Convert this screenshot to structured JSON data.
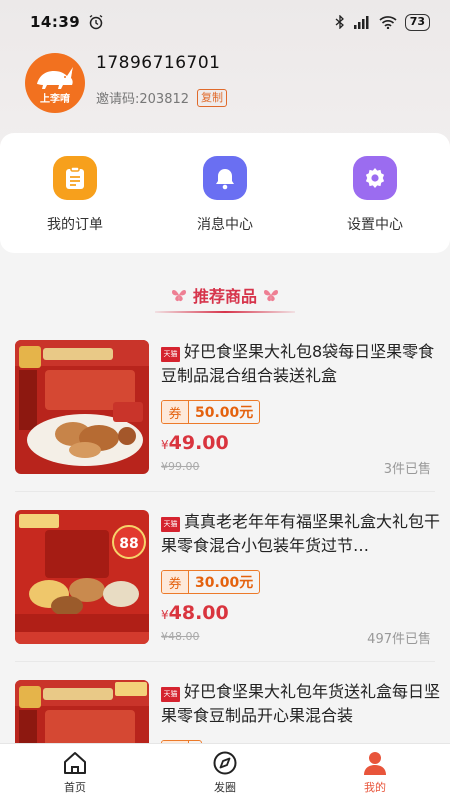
{
  "status": {
    "time": "14:39",
    "battery": "73"
  },
  "profile": {
    "phone": "17896716701",
    "invite_label": "邀请码:203812",
    "copy_label": "复制",
    "avatar_text": "上李唷"
  },
  "quick_actions": [
    {
      "label": "我的订单",
      "icon": "order-icon",
      "color": "#f7a01c"
    },
    {
      "label": "消息中心",
      "icon": "bell-icon",
      "color": "#6a6ff2"
    },
    {
      "label": "设置中心",
      "icon": "gear-icon",
      "color": "#9b6cf0"
    }
  ],
  "recommend_title": "推荐商品",
  "products": [
    {
      "store_tag": "天猫",
      "title": "好巴食坚果大礼包8袋每日坚果零食豆制品混合组合装送礼盒",
      "coupon_tag": "券",
      "coupon_value": "50.00元",
      "price": "49.00",
      "currency": "¥",
      "original_price": "¥99.00",
      "sold": "3件已售"
    },
    {
      "store_tag": "天猫",
      "title": "真真老老年年有福坚果礼盒大礼包干果零食混合小包装年货过节…",
      "coupon_tag": "券",
      "coupon_value": "30.00元",
      "price": "48.00",
      "currency": "¥",
      "original_price": "¥48.00",
      "sold": "497件已售"
    },
    {
      "store_tag": "天猫",
      "title": "好巴食坚果大礼包年货送礼盒每日坚果零食豆制品开心果混合装",
      "coupon_tag": "券",
      "coupon_value": "",
      "price": "",
      "currency": "",
      "original_price": "",
      "sold": ""
    }
  ],
  "nav": [
    {
      "label": "首页",
      "icon": "home-icon"
    },
    {
      "label": "发圈",
      "icon": "compass-icon"
    },
    {
      "label": "我的",
      "icon": "user-icon"
    }
  ],
  "colors": {
    "accent": "#e8553b",
    "price": "#d9343e",
    "coupon": "#ec7a2a"
  }
}
